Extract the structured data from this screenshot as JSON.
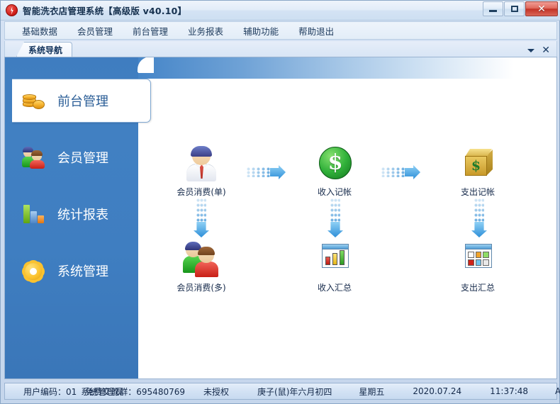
{
  "window": {
    "title": "智能洗衣店管理系统【高级版 v40.10】",
    "app_icon": "lightning-bolt-icon",
    "controls": {
      "minimize": "–",
      "maximize": "□",
      "close": "✕"
    }
  },
  "menubar": {
    "items": [
      {
        "label": "基础数据"
      },
      {
        "label": "会员管理"
      },
      {
        "label": "前台管理"
      },
      {
        "label": "业务报表"
      },
      {
        "label": "辅助功能"
      },
      {
        "label": "帮助退出"
      }
    ]
  },
  "tabstrip": {
    "tabs": [
      {
        "label": "系统导航",
        "active": true
      }
    ],
    "caret": "▾",
    "close": "✕"
  },
  "sidebar": {
    "items": [
      {
        "label": "前台管理",
        "icon": "coins-icon",
        "active": true
      },
      {
        "label": "会员管理",
        "icon": "two-people-icon",
        "active": false
      },
      {
        "label": "统计报表",
        "icon": "bar-chart-icon",
        "active": false
      },
      {
        "label": "系统管理",
        "icon": "gear-icon",
        "active": false
      }
    ]
  },
  "workflow": {
    "nodes": [
      {
        "id": "member-consume-single",
        "label": "会员消费(单)",
        "icon": "businessman-icon"
      },
      {
        "id": "income-record",
        "label": "收入记帐",
        "icon": "green-dollar-circle-icon"
      },
      {
        "id": "expense-record",
        "label": "支出记帐",
        "icon": "gold-box-dollar-icon"
      },
      {
        "id": "member-consume-multi",
        "label": "会员消费(多)",
        "icon": "two-people-icon"
      },
      {
        "id": "income-summary",
        "label": "收入汇总",
        "icon": "chart-window-icon"
      },
      {
        "id": "expense-summary",
        "label": "支出汇总",
        "icon": "grid-window-icon"
      }
    ],
    "arrows": [
      {
        "id": "arrow-1",
        "direction": "right"
      },
      {
        "id": "arrow-2",
        "direction": "right"
      },
      {
        "id": "arrow-3",
        "direction": "down"
      },
      {
        "id": "arrow-4",
        "direction": "down"
      },
      {
        "id": "arrow-5",
        "direction": "down"
      }
    ]
  },
  "statusbar": {
    "user_code": "用户编码：01",
    "role": "系统管理员",
    "qq_group": "免费交流群：695480769",
    "license": "未授权",
    "lunar_date": "庚子(鼠)年六月初四",
    "weekday": "星期五",
    "date": "2020.07.24",
    "time": "11:37:48",
    "database": "Access"
  },
  "colors": {
    "sidebar_blue": "#3f7dc0",
    "accent_blue": "#2e8fd8",
    "title_text": "#16314f",
    "close_red": "#c33327"
  }
}
